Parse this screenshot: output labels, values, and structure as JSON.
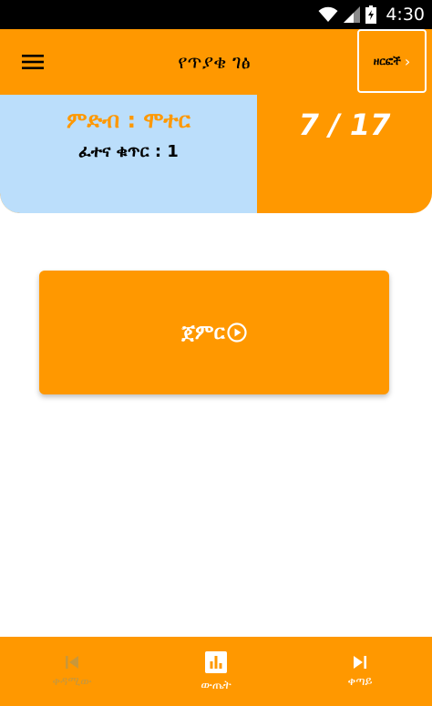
{
  "status_bar": {
    "time": "4:30"
  },
  "app_bar": {
    "title": "የጥያቄ ገፅ",
    "categories_label": "ዘርፎች",
    "categories_chevron": "›"
  },
  "info": {
    "topic": "ምድብ  : ሞተር",
    "exam_number": "ፈተና ቁጥር : 1",
    "progress": "7 / 17"
  },
  "start_button": {
    "label": "ጀምር"
  },
  "bottom_nav": {
    "items": [
      {
        "label": "ቀዳሚው",
        "icon": "skip-previous-icon",
        "enabled": false
      },
      {
        "label": "ውጤት",
        "icon": "chart-icon",
        "enabled": true
      },
      {
        "label": "ቀጣይ",
        "icon": "skip-next-icon",
        "enabled": true
      }
    ]
  },
  "colors": {
    "primary": "#FF9800",
    "card_left": "#BBDEFB",
    "status_bar": "#000000",
    "disabled_nav": "#C9973A"
  }
}
